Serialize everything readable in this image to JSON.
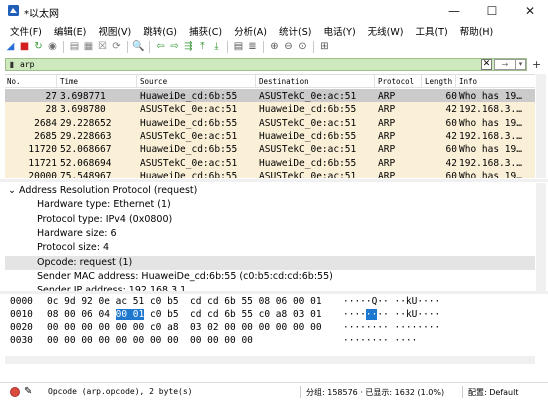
{
  "window": {
    "title": "*以太网",
    "minimize": "—",
    "maximize": "☐",
    "close": "✕"
  },
  "menu": [
    "文件(F)",
    "编辑(E)",
    "视图(V)",
    "跳转(G)",
    "捕获(C)",
    "分析(A)",
    "统计(S)",
    "电话(Y)",
    "无线(W)",
    "工具(T)",
    "帮助(H)"
  ],
  "toolbar_icons": [
    {
      "name": "shark-fin-start-icon",
      "glyph": "◢",
      "color": "#2a6fd6"
    },
    {
      "name": "stop-capture-icon",
      "glyph": "■",
      "color": "#d21f1f"
    },
    {
      "name": "restart-capture-icon",
      "glyph": "↻",
      "color": "#3a9a3a"
    },
    {
      "name": "capture-options-icon",
      "glyph": "◉",
      "color": "#707070"
    },
    {
      "name": "open-file-icon",
      "glyph": "▤",
      "color": "#808080"
    },
    {
      "name": "save-file-icon",
      "glyph": "▦",
      "color": "#808080"
    },
    {
      "name": "close-file-icon",
      "glyph": "☒",
      "color": "#808080"
    },
    {
      "name": "reload-file-icon",
      "glyph": "⟳",
      "color": "#808080"
    },
    {
      "name": "find-packet-icon",
      "glyph": "🔍",
      "color": "#555555"
    },
    {
      "name": "go-back-icon",
      "glyph": "⇦",
      "color": "#3a9a3a"
    },
    {
      "name": "go-forward-icon",
      "glyph": "⇨",
      "color": "#3a9a3a"
    },
    {
      "name": "go-to-packet-icon",
      "glyph": "⇶",
      "color": "#3a9a3a"
    },
    {
      "name": "go-first-icon",
      "glyph": "⤒",
      "color": "#3a9a3a"
    },
    {
      "name": "go-last-icon",
      "glyph": "⤓",
      "color": "#3a9a3a"
    },
    {
      "name": "auto-scroll-icon",
      "glyph": "▤",
      "color": "#555555"
    },
    {
      "name": "colorize-icon",
      "glyph": "≣",
      "color": "#555555"
    },
    {
      "name": "zoom-in-icon",
      "glyph": "⊕",
      "color": "#555555"
    },
    {
      "name": "zoom-out-icon",
      "glyph": "⊖",
      "color": "#555555"
    },
    {
      "name": "zoom-reset-icon",
      "glyph": "⊙",
      "color": "#555555"
    },
    {
      "name": "resize-columns-icon",
      "glyph": "⊞",
      "color": "#555555"
    }
  ],
  "filter": {
    "value": "arp",
    "clear": "✕",
    "apply": "→",
    "dropdown": "▾",
    "add": "+",
    "bookmark": "▮"
  },
  "packet_list": {
    "columns": [
      "No.",
      "Time",
      "Source",
      "Destination",
      "Protocol",
      "Length",
      "Info"
    ],
    "rows": [
      {
        "no": "27",
        "time": "3.698771",
        "src": "HuaweiDe_cd:6b:55",
        "dst": "ASUSTekC_0e:ac:51",
        "proto": "ARP",
        "len": "60",
        "info": "Who has 19…",
        "selected": true
      },
      {
        "no": "28",
        "time": "3.698780",
        "src": "ASUSTekC_0e:ac:51",
        "dst": "HuaweiDe_cd:6b:55",
        "proto": "ARP",
        "len": "42",
        "info": "192.168.3.…",
        "selected": false
      },
      {
        "no": "2684",
        "time": "29.228652",
        "src": "HuaweiDe_cd:6b:55",
        "dst": "ASUSTekC_0e:ac:51",
        "proto": "ARP",
        "len": "60",
        "info": "Who has 19…",
        "selected": false
      },
      {
        "no": "2685",
        "time": "29.228663",
        "src": "ASUSTekC_0e:ac:51",
        "dst": "HuaweiDe_cd:6b:55",
        "proto": "ARP",
        "len": "42",
        "info": "192.168.3.…",
        "selected": false
      },
      {
        "no": "11720",
        "time": "52.068667",
        "src": "HuaweiDe_cd:6b:55",
        "dst": "ASUSTekC_0e:ac:51",
        "proto": "ARP",
        "len": "60",
        "info": "Who has 19…",
        "selected": false
      },
      {
        "no": "11721",
        "time": "52.068694",
        "src": "ASUSTekC_0e:ac:51",
        "dst": "HuaweiDe_cd:6b:55",
        "proto": "ARP",
        "len": "42",
        "info": "192.168.3.…",
        "selected": false
      },
      {
        "no": "20000",
        "time": "75.548967",
        "src": "HuaweiDe_cd:6b:55",
        "dst": "ASUSTekC_0e:ac:51",
        "proto": "ARP",
        "len": "60",
        "info": "Who has 19…",
        "selected": false
      }
    ]
  },
  "details": {
    "lines": [
      {
        "text": "Address Resolution Protocol (request)",
        "indent": 0,
        "toggle": "⌄",
        "highlight": false
      },
      {
        "text": "Hardware type: Ethernet (1)",
        "indent": 1,
        "toggle": "",
        "highlight": false
      },
      {
        "text": "Protocol type: IPv4 (0x0800)",
        "indent": 1,
        "toggle": "",
        "highlight": false
      },
      {
        "text": "Hardware size: 6",
        "indent": 1,
        "toggle": "",
        "highlight": false
      },
      {
        "text": "Protocol size: 4",
        "indent": 1,
        "toggle": "",
        "highlight": false
      },
      {
        "text": "Opcode: request (1)",
        "indent": 1,
        "toggle": "",
        "highlight": true
      },
      {
        "text": "Sender MAC address: HuaweiDe_cd:6b:55 (c0:b5:cd:cd:6b:55)",
        "indent": 1,
        "toggle": "",
        "highlight": false
      },
      {
        "text": "Sender IP address: 192.168.3.1",
        "indent": 1,
        "toggle": "",
        "highlight": false
      }
    ]
  },
  "bytes": {
    "rows": [
      {
        "offset": "0000",
        "hex_a": "0c 9d 92 0e ac 51 c0 b5  cd cd 6b 55 08 06 00 01",
        "hex_sel": "",
        "hex_b": "",
        "ascii_a": "·····Q·· ··kU····",
        "ascii_sel": "",
        "ascii_b": ""
      },
      {
        "offset": "0010",
        "hex_a": "08 00 06 04 ",
        "hex_sel": "00 01",
        "hex_b": " c0 b5  cd cd 6b 55 c0 a8 03 01",
        "ascii_a": "····",
        "ascii_sel": "··",
        "ascii_b": "·· ··kU····"
      },
      {
        "offset": "0020",
        "hex_a": "00 00 00 00 00 00 c0 a8  03 02 00 00 00 00 00 00",
        "hex_sel": "",
        "hex_b": "",
        "ascii_a": "········ ········",
        "ascii_sel": "",
        "ascii_b": ""
      },
      {
        "offset": "0030",
        "hex_a": "00 00 00 00 00 00 00 00  00 00 00 00",
        "hex_sel": "",
        "hex_b": "",
        "ascii_a": "········ ····",
        "ascii_sel": "",
        "ascii_b": ""
      }
    ]
  },
  "status": {
    "field_info": "Opcode (arp.opcode), 2 byte(s)",
    "packets": "分组: 158576 · 已显示: 1632 (1.0%)",
    "profile": "配置: Default"
  }
}
